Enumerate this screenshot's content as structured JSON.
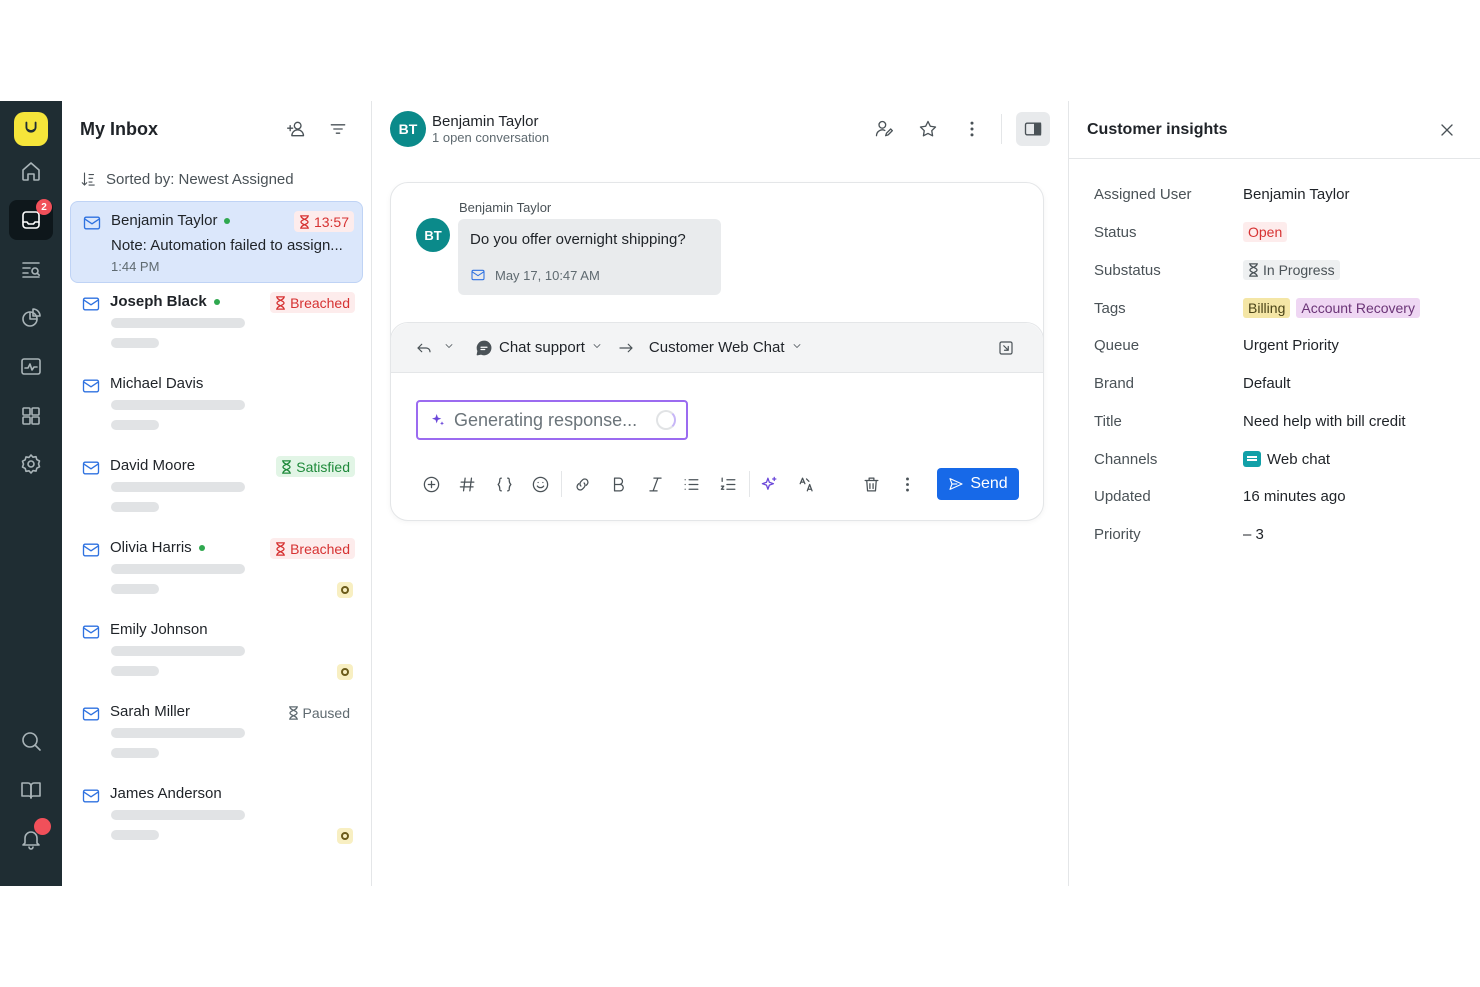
{
  "rail": {
    "items": [
      {
        "icon": "home-icon"
      },
      {
        "icon": "inbox-icon",
        "badge": "2",
        "active": true
      },
      {
        "icon": "search-list-icon"
      },
      {
        "icon": "reports-icon"
      },
      {
        "icon": "monitor-icon"
      },
      {
        "icon": "apps-icon"
      },
      {
        "icon": "gear-icon"
      }
    ],
    "bottom": [
      {
        "icon": "search-icon"
      },
      {
        "icon": "book-icon"
      },
      {
        "icon": "bell-icon"
      }
    ]
  },
  "inbox": {
    "title": "My Inbox",
    "sort_label": "Sorted by: Newest Assigned",
    "conversations": [
      {
        "name": "Benjamin Taylor",
        "online": true,
        "badge": "13:57",
        "badge_type": "red",
        "note": "Note: Automation failed to assign...",
        "time": "1:44 PM",
        "selected": true
      },
      {
        "name": "Joseph Black",
        "online": true,
        "bold": true,
        "badge": "Breached",
        "badge_type": "red"
      },
      {
        "name": "Michael Davis"
      },
      {
        "name": "David Moore",
        "badge": "Satisfied",
        "badge_type": "green"
      },
      {
        "name": "Olivia Harris",
        "online": true,
        "badge": "Breached",
        "badge_type": "red",
        "bot": true
      },
      {
        "name": "Emily Johnson",
        "bot": true
      },
      {
        "name": "Sarah Miller",
        "badge": "Paused",
        "badge_type": "grey"
      },
      {
        "name": "James Anderson",
        "bot": true
      }
    ]
  },
  "conversation": {
    "initials": "BT",
    "name": "Benjamin Taylor",
    "subtitle": "1 open conversation",
    "message": {
      "author": "Benjamin Taylor",
      "text": "Do you offer overnight shipping?",
      "timestamp": "May 17, 10:47 AM"
    },
    "composer": {
      "channel": "Chat support",
      "destination": "Customer Web Chat",
      "generating": "Generating response...",
      "send_label": "Send"
    }
  },
  "insights": {
    "title": "Customer insights",
    "fields": {
      "assigned_user": {
        "label": "Assigned User",
        "value": "Benjamin Taylor"
      },
      "status": {
        "label": "Status",
        "value": "Open"
      },
      "substatus": {
        "label": "Substatus",
        "value": "In Progress"
      },
      "tags": {
        "label": "Tags",
        "values": [
          "Billing",
          "Account Recovery"
        ]
      },
      "queue": {
        "label": "Queue",
        "value": "Urgent Priority"
      },
      "brand": {
        "label": "Brand",
        "value": "Default"
      },
      "title": {
        "label": "Title",
        "value": "Need help with bill credit"
      },
      "channels": {
        "label": "Channels",
        "value": "Web chat"
      },
      "updated": {
        "label": "Updated",
        "value": "16 minutes ago"
      },
      "priority": {
        "label": "Priority",
        "value": "– 3"
      }
    }
  },
  "colors": {
    "rail": "#1f2d33",
    "accent": "#1769e8",
    "selected_row": "#dbe7fb",
    "logo": "#f6e53a"
  }
}
